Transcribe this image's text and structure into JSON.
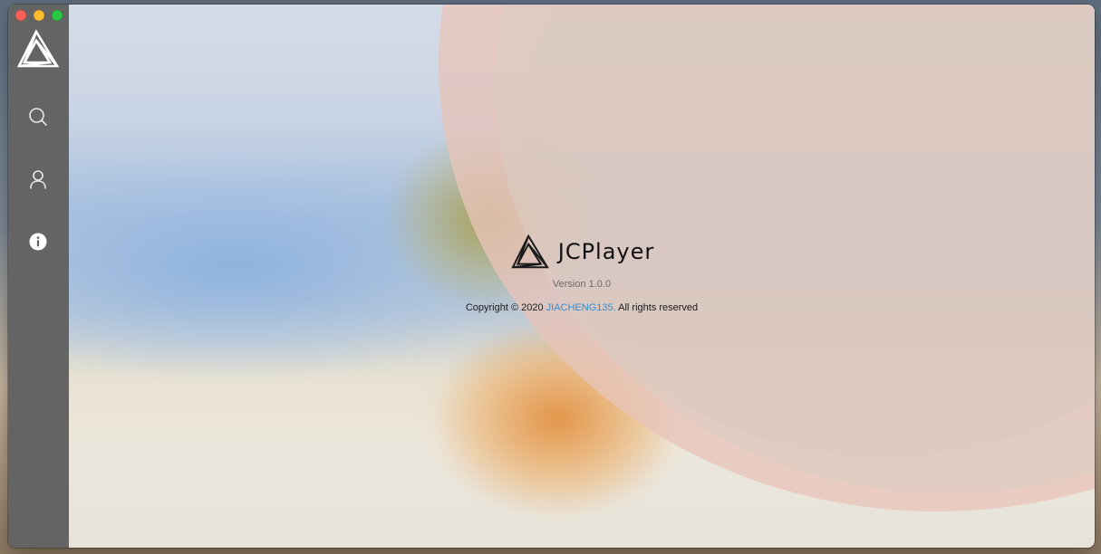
{
  "window": {
    "controls": {
      "close": "close-button",
      "minimize": "minimize-button",
      "maximize": "zoom-button"
    }
  },
  "sidebar": {
    "logo": "jcplayer-logo-icon",
    "items": [
      {
        "name": "search",
        "icon": "search-icon"
      },
      {
        "name": "user",
        "icon": "user-icon"
      },
      {
        "name": "about",
        "icon": "info-icon",
        "active": true
      }
    ]
  },
  "about": {
    "app_name": "JCPlayer",
    "version": "Version 1.0.0",
    "copyright_prefix": "Copyright © 2020 ",
    "author_link": "JIACHENG135.",
    "copyright_suffix": " All rights reserved"
  },
  "colors": {
    "sidebar": "#646464",
    "link": "#2f8fd8",
    "close": "#fe5f57",
    "minimize": "#febc2e",
    "maximize": "#28c840"
  }
}
